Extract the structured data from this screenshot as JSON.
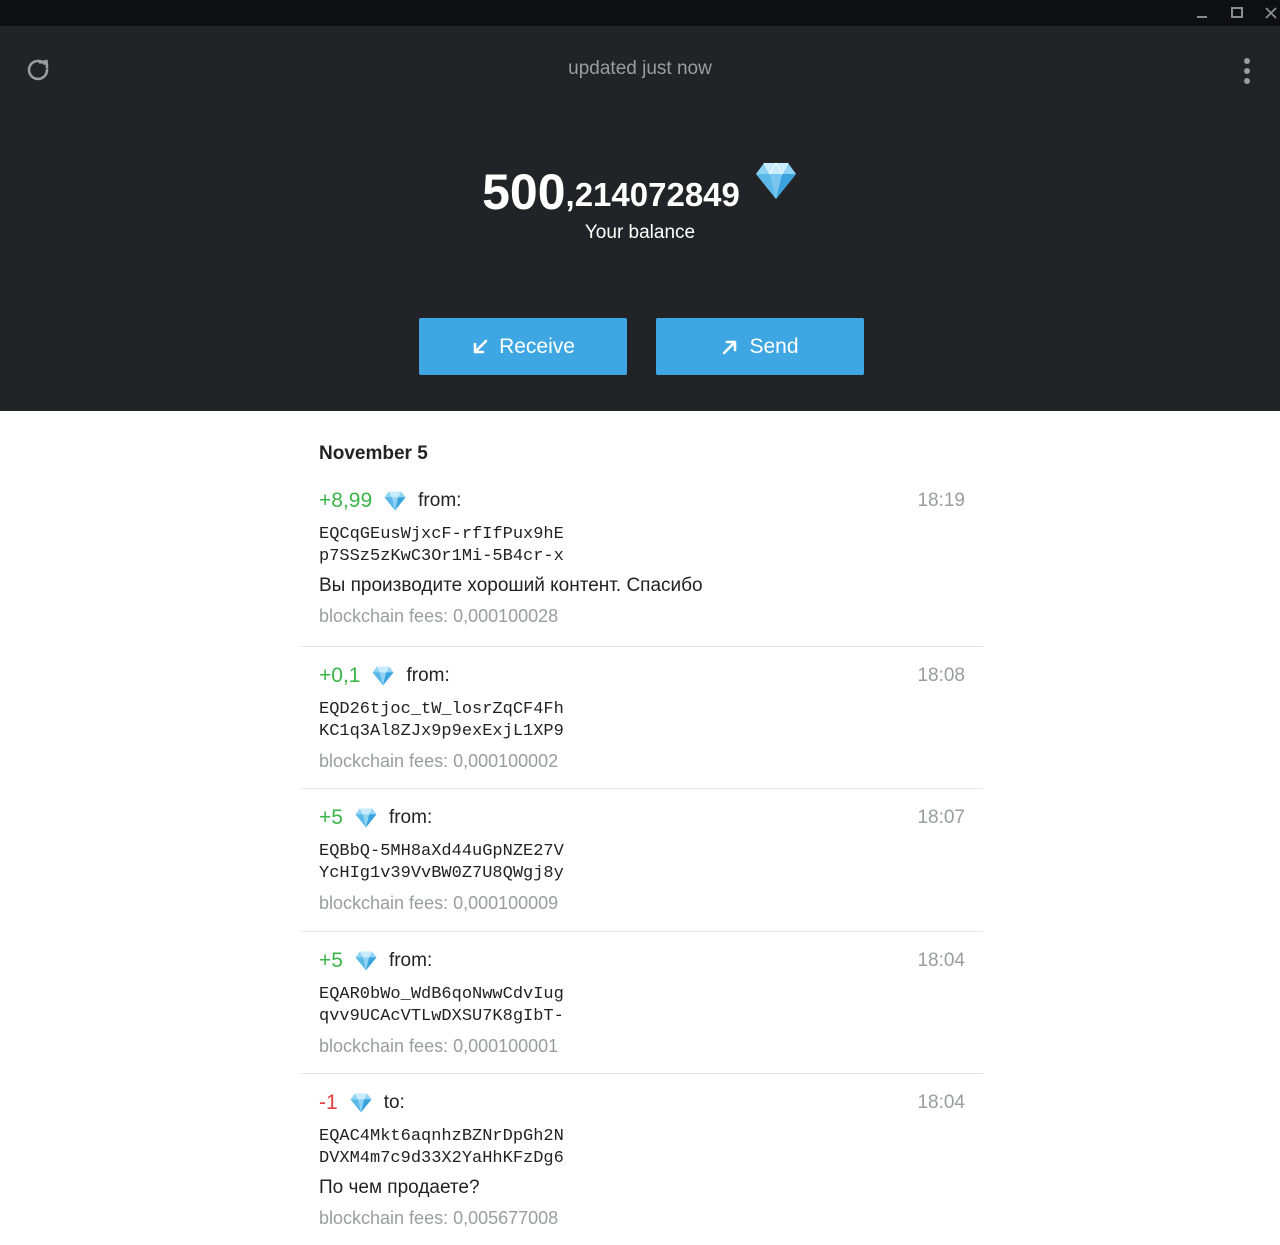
{
  "window": {
    "controls": [
      "minimize-icon",
      "maximize-icon",
      "close-icon"
    ]
  },
  "header": {
    "status": "updated just now",
    "balance_int": "500",
    "balance_frac": ",214072849",
    "balance_label": "Your balance",
    "receive_label": "Receive",
    "send_label": "Send"
  },
  "colors": {
    "header_bg": "#222326",
    "accent": "#3ea6e3",
    "incoming": "#3bb54a",
    "outgoing": "#e04040",
    "muted": "#9a9ca0"
  },
  "history": {
    "date": "November 5",
    "tx": [
      {
        "amount": "+8,99",
        "direction": "from:",
        "time": "18:19",
        "addr1": "EQCqGEusWjxcF-rfIfPux9hE",
        "addr2": "p7SSz5zKwC3Or1Mi-5B4cr-x",
        "comment": "Вы производите хороший контент. Спасибо",
        "fee": "blockchain fees: 0,000100028"
      },
      {
        "amount": "+0,1",
        "direction": "from:",
        "time": "18:08",
        "addr1": "EQD26tjoc_tW_losrZqCF4Fh",
        "addr2": "KC1q3Al8ZJx9p9exExjL1XP9",
        "comment": "",
        "fee": "blockchain fees: 0,000100002"
      },
      {
        "amount": "+5",
        "direction": "from:",
        "time": "18:07",
        "addr1": "EQBbQ-5MH8aXd44uGpNZE27V",
        "addr2": "YcHIg1v39VvBW0Z7U8QWgj8y",
        "comment": "",
        "fee": "blockchain fees: 0,000100009"
      },
      {
        "amount": "+5",
        "direction": "from:",
        "time": "18:04",
        "addr1": "EQAR0bWo_WdB6qoNwwCdvIug",
        "addr2": "qvv9UCAcVTLwDXSU7K8gIbT-",
        "comment": "",
        "fee": "blockchain fees: 0,000100001"
      },
      {
        "amount": "-1",
        "direction": "to:",
        "time": "18:04",
        "addr1": "EQAC4Mkt6aqnhzBZNrDpGh2N",
        "addr2": "DVXM4m7c9d33X2YaHhKFzDg6",
        "comment": "По чем продаете?",
        "fee": "blockchain fees: 0,005677008"
      }
    ]
  }
}
